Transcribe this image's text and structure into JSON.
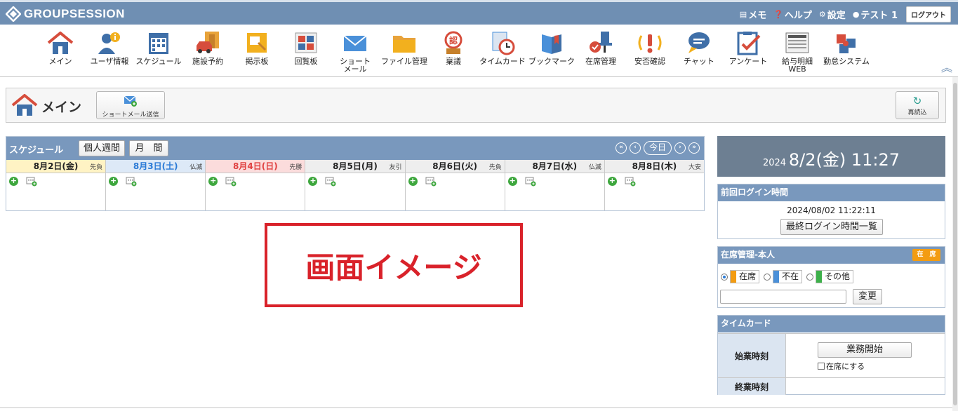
{
  "header": {
    "logo_text": "GROUPSESSION",
    "links": [
      {
        "icon": "memo-icon",
        "label": "メモ"
      },
      {
        "icon": "help-icon",
        "label": "ヘルプ"
      },
      {
        "icon": "gear-icon",
        "label": "設定"
      },
      {
        "icon": "user-icon",
        "label": "テスト 1"
      }
    ],
    "logout_label": "ログアウト"
  },
  "apps": [
    {
      "label": "メイン",
      "icon": "home-icon"
    },
    {
      "label": "ユーザ情報",
      "icon": "user-info-icon"
    },
    {
      "label": "スケジュール",
      "icon": "calendar-icon"
    },
    {
      "label": "施設予約",
      "icon": "facility-icon"
    },
    {
      "label": "掲示板",
      "icon": "bulletin-icon"
    },
    {
      "label": "回覧板",
      "icon": "circular-icon"
    },
    {
      "label": "ショート\nメール",
      "icon": "mail-icon"
    },
    {
      "label": "ファイル管理",
      "icon": "folder-icon"
    },
    {
      "label": "稟議",
      "icon": "approval-stamp-icon"
    },
    {
      "label": "タイムカード",
      "icon": "timecard-icon"
    },
    {
      "label": "ブックマーク",
      "icon": "bookmark-icon"
    },
    {
      "label": "在席管理",
      "icon": "presence-icon"
    },
    {
      "label": "安否確認",
      "icon": "safety-icon"
    },
    {
      "label": "チャット",
      "icon": "chat-icon"
    },
    {
      "label": "アンケート",
      "icon": "survey-icon"
    },
    {
      "label": "給与明細\nWEB",
      "icon": "payslip-icon"
    },
    {
      "label": "勤怠システム",
      "icon": "attendance-icon"
    }
  ],
  "main": {
    "title": "メイン",
    "shortmail_button": "ショートメール送信",
    "reload_button": "再読込"
  },
  "schedule": {
    "title": "スケジュール",
    "btn_week": "個人週間",
    "btn_month": "月　間",
    "today": "今日",
    "days": [
      {
        "date": "8月2日(金)",
        "rokuyo": "先負",
        "bg": "#fff3c4",
        "color": "#222222"
      },
      {
        "date": "8月3日(土)",
        "rokuyo": "仏滅",
        "bg": "#dde9f7",
        "color": "#2a7ad6"
      },
      {
        "date": "8月4日(日)",
        "rokuyo": "先勝",
        "bg": "#fbdcdc",
        "color": "#e04040"
      },
      {
        "date": "8月5日(月)",
        "rokuyo": "友引",
        "bg": "#eeeeee",
        "color": "#222222"
      },
      {
        "date": "8月6日(火)",
        "rokuyo": "先負",
        "bg": "#eeeeee",
        "color": "#222222"
      },
      {
        "date": "8月7日(水)",
        "rokuyo": "仏滅",
        "bg": "#eeeeee",
        "color": "#222222"
      },
      {
        "date": "8月8日(木)",
        "rokuyo": "大安",
        "bg": "#eeeeee",
        "color": "#222222"
      }
    ]
  },
  "overlay_text": "画面イメージ",
  "clock": {
    "year": "2024",
    "datetime": "8/2(金) 11:27"
  },
  "last_login": {
    "title": "前回ログイン時間",
    "time": "2024/08/02 11:22:11",
    "button": "最終ログイン時間一覧"
  },
  "presence": {
    "title": "在席管理-本人",
    "badge": "在　席",
    "options": [
      {
        "label": "在席",
        "color": "#f39c12",
        "selected": true
      },
      {
        "label": "不在",
        "color": "#4a90d9",
        "selected": false
      },
      {
        "label": "その他",
        "color": "#3db04a",
        "selected": false
      }
    ],
    "comment_value": "",
    "change_button": "変更"
  },
  "timecard": {
    "title": "タイムカード",
    "start_label": "始業時刻",
    "start_button": "業務開始",
    "checkbox_label": "在席にする",
    "end_label": "終業時刻"
  },
  "colors": {
    "header_bg": "#6f8fb3",
    "panel_head": "#7998bd",
    "accent_red": "#d9222a"
  }
}
